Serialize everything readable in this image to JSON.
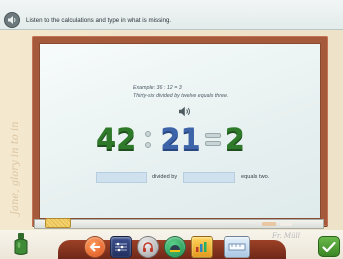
{
  "instruction": {
    "text": "Listen to the calculations and type in what is missing."
  },
  "wall": {
    "decor_text": "Jane, glory in to in"
  },
  "example": {
    "line1": "Example: 36 : 12 = 3",
    "line2": "Thirty-six divided by twelve equals three."
  },
  "equation": {
    "dividend": "42",
    "divisor": "21",
    "quotient": "2",
    "colors": {
      "dividend": "#2f7a2a",
      "divisor": "#3d64a8",
      "quotient": "#2f7a2a"
    }
  },
  "answer": {
    "first_value": "",
    "middle_label": "divided by",
    "second_value": "",
    "end_label": "equals two."
  },
  "board": {
    "signature": "Fr. Müll"
  },
  "icons": {
    "instruction_speaker": "speaker-icon",
    "example_speaker": "speaker-icon",
    "toolbar": [
      "arrow-icon",
      "abacus-icon",
      "headphones-icon",
      "helmet-icon",
      "chart-icon",
      "ruler-icon"
    ],
    "check": "check-icon",
    "bottle": "bottle-icon"
  }
}
